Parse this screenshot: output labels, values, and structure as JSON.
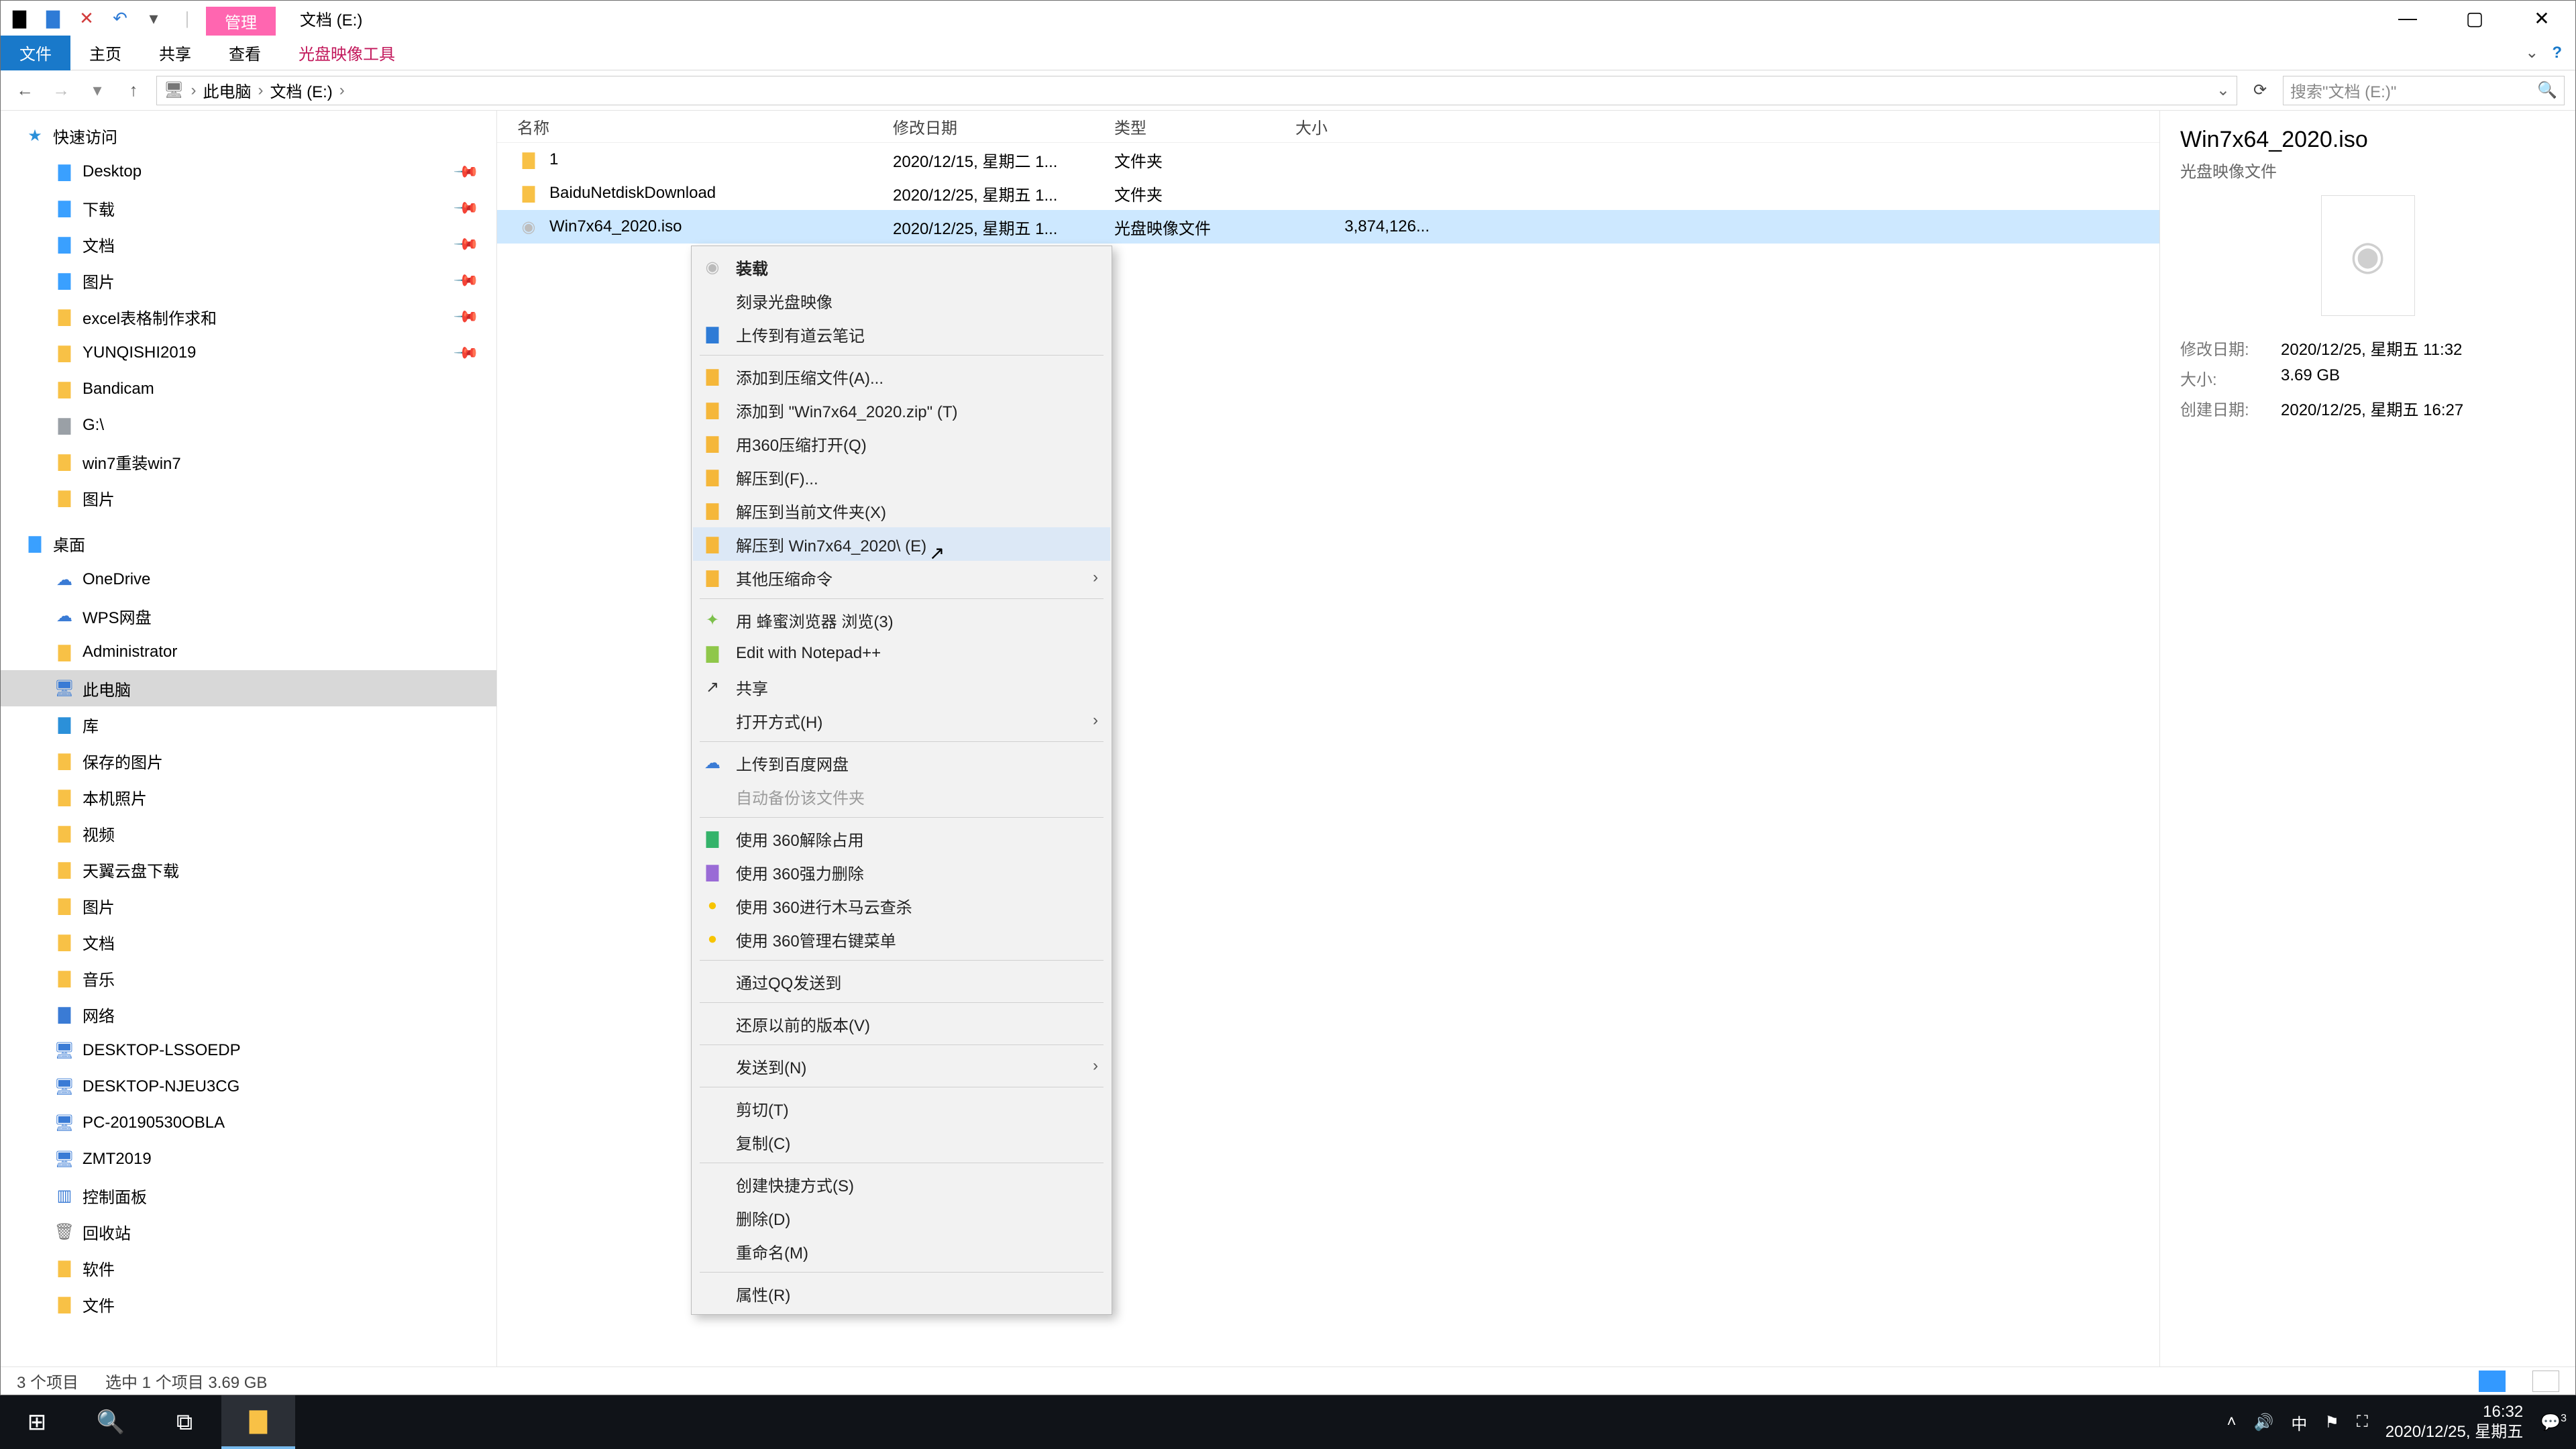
{
  "window": {
    "context_tab": "管理",
    "title": "文档 (E:)",
    "ribbon": {
      "file": "文件",
      "home": "主页",
      "share": "共享",
      "view": "查看",
      "disc_tools": "光盘映像工具"
    },
    "search_placeholder": "搜索\"文档 (E:)\""
  },
  "breadcrumb": {
    "pc": "此电脑",
    "drive": "文档 (E:)"
  },
  "tree": {
    "quick": "快速访问",
    "quick_items": [
      "Desktop",
      "下载",
      "文档",
      "图片",
      "excel表格制作求和",
      "YUNQISHI2019",
      "Bandicam",
      "G:\\",
      "win7重装win7",
      "图片"
    ],
    "desktop": "桌面",
    "desktop_items": [
      "OneDrive",
      "WPS网盘",
      "Administrator",
      "此电脑",
      "库"
    ],
    "lib_items": [
      "保存的图片",
      "本机照片",
      "视频",
      "天翼云盘下载",
      "图片",
      "文档",
      "音乐"
    ],
    "network": "网络",
    "net_items": [
      "DESKTOP-LSSOEDP",
      "DESKTOP-NJEU3CG",
      "PC-20190530OBLA",
      "ZMT2019"
    ],
    "tail": [
      "控制面板",
      "回收站",
      "软件",
      "文件"
    ]
  },
  "columns": {
    "name": "名称",
    "date": "修改日期",
    "type": "类型",
    "size": "大小"
  },
  "rows": [
    {
      "name": "1",
      "date": "2020/12/15, 星期二 1...",
      "type": "文件夹",
      "size": ""
    },
    {
      "name": "BaiduNetdiskDownload",
      "date": "2020/12/25, 星期五 1...",
      "type": "文件夹",
      "size": ""
    },
    {
      "name": "Win7x64_2020.iso",
      "date": "2020/12/25, 星期五 1...",
      "type": "光盘映像文件",
      "size": "3,874,126..."
    }
  ],
  "preview": {
    "title": "Win7x64_2020.iso",
    "subtitle": "光盘映像文件",
    "mod_k": "修改日期:",
    "mod_v": "2020/12/25, 星期五 11:32",
    "size_k": "大小:",
    "size_v": "3.69 GB",
    "crt_k": "创建日期:",
    "crt_v": "2020/12/25, 星期五 16:27"
  },
  "status": {
    "count": "3 个项目",
    "sel": "选中 1 个项目  3.69 GB"
  },
  "menu": [
    {
      "t": "item",
      "ico": "disc",
      "label": "装载",
      "bold": true
    },
    {
      "t": "item",
      "ico": "",
      "label": "刻录光盘映像"
    },
    {
      "t": "item",
      "ico": "note",
      "label": "上传到有道云笔记"
    },
    {
      "t": "sep"
    },
    {
      "t": "item",
      "ico": "zip",
      "label": "添加到压缩文件(A)..."
    },
    {
      "t": "item",
      "ico": "zip",
      "label": "添加到 \"Win7x64_2020.zip\" (T)"
    },
    {
      "t": "item",
      "ico": "zip",
      "label": "用360压缩打开(Q)"
    },
    {
      "t": "item",
      "ico": "zip",
      "label": "解压到(F)..."
    },
    {
      "t": "item",
      "ico": "zip",
      "label": "解压到当前文件夹(X)"
    },
    {
      "t": "item",
      "ico": "zip",
      "label": "解压到 Win7x64_2020\\ (E)",
      "hover": true
    },
    {
      "t": "item",
      "ico": "cube",
      "label": "其他压缩命令",
      "sub": true
    },
    {
      "t": "sep"
    },
    {
      "t": "item",
      "ico": "bee",
      "label": "用 蜂蜜浏览器 浏览(3)"
    },
    {
      "t": "item",
      "ico": "npp",
      "label": "Edit with Notepad++"
    },
    {
      "t": "item",
      "ico": "share",
      "label": "共享"
    },
    {
      "t": "item",
      "ico": "",
      "label": "打开方式(H)",
      "sub": true
    },
    {
      "t": "sep"
    },
    {
      "t": "item",
      "ico": "baidu",
      "label": "上传到百度网盘"
    },
    {
      "t": "item",
      "ico": "",
      "label": "自动备份该文件夹",
      "disabled": true
    },
    {
      "t": "sep"
    },
    {
      "t": "item",
      "ico": "sh-green",
      "label": "使用 360解除占用"
    },
    {
      "t": "item",
      "ico": "sh-purple",
      "label": "使用 360强力删除"
    },
    {
      "t": "item",
      "ico": "sh-yell",
      "label": "使用 360进行木马云查杀"
    },
    {
      "t": "item",
      "ico": "sh-yell2",
      "label": "使用 360管理右键菜单"
    },
    {
      "t": "sep"
    },
    {
      "t": "item",
      "ico": "",
      "label": "通过QQ发送到"
    },
    {
      "t": "sep"
    },
    {
      "t": "item",
      "ico": "",
      "label": "还原以前的版本(V)"
    },
    {
      "t": "sep"
    },
    {
      "t": "item",
      "ico": "",
      "label": "发送到(N)",
      "sub": true
    },
    {
      "t": "sep"
    },
    {
      "t": "item",
      "ico": "",
      "label": "剪切(T)"
    },
    {
      "t": "item",
      "ico": "",
      "label": "复制(C)"
    },
    {
      "t": "sep"
    },
    {
      "t": "item",
      "ico": "",
      "label": "创建快捷方式(S)"
    },
    {
      "t": "item",
      "ico": "",
      "label": "删除(D)"
    },
    {
      "t": "item",
      "ico": "",
      "label": "重命名(M)"
    },
    {
      "t": "sep"
    },
    {
      "t": "item",
      "ico": "",
      "label": "属性(R)"
    }
  ],
  "taskbar": {
    "ime": "中",
    "time": "16:32",
    "date": "2020/12/25, 星期五",
    "badge": "3"
  }
}
